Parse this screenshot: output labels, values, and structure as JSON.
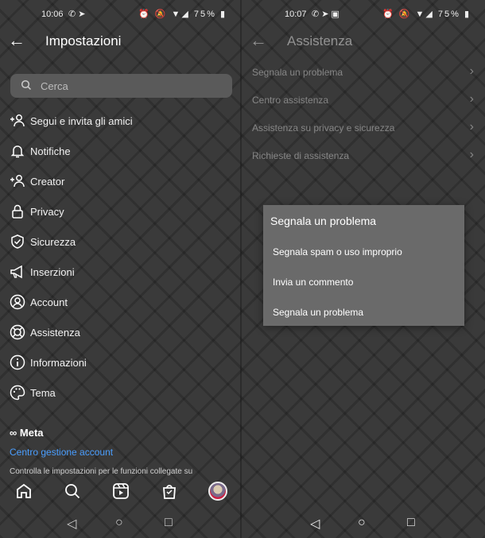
{
  "left": {
    "status": {
      "time": "10:06",
      "battery": "75%"
    },
    "header": {
      "title": "Impostazioni"
    },
    "search": {
      "placeholder": "Cerca"
    },
    "menu": [
      {
        "label": "Segui e invita gli amici",
        "icon": "add-person-icon"
      },
      {
        "label": "Notifiche",
        "icon": "bell-icon"
      },
      {
        "label": "Creator",
        "icon": "add-person-icon"
      },
      {
        "label": "Privacy",
        "icon": "lock-icon"
      },
      {
        "label": "Sicurezza",
        "icon": "shield-icon"
      },
      {
        "label": "Inserzioni",
        "icon": "megaphone-icon"
      },
      {
        "label": "Account",
        "icon": "account-icon"
      },
      {
        "label": "Assistenza",
        "icon": "lifebuoy-icon"
      },
      {
        "label": "Informazioni",
        "icon": "info-icon"
      },
      {
        "label": "Tema",
        "icon": "palette-icon"
      }
    ],
    "meta_logo": "Meta",
    "account_center_link": "Centro gestione account",
    "account_center_desc": "Controlla le impostazioni per le funzioni collegate su"
  },
  "right": {
    "status": {
      "time": "10:07",
      "battery": "75%"
    },
    "header": {
      "title": "Assistenza"
    },
    "items": [
      {
        "label": "Segnala un problema"
      },
      {
        "label": "Centro assistenza"
      },
      {
        "label": "Assistenza su privacy e sicurezza"
      },
      {
        "label": "Richieste di assistenza"
      }
    ],
    "dialog": {
      "title": "Segnala un problema",
      "options": [
        "Segnala spam o uso improprio",
        "Invia un commento",
        "Segnala un problema"
      ]
    }
  },
  "colors": {
    "link": "#4a9eff",
    "dialog_bg": "#6a6a6a",
    "search_bg": "#5a5a5a"
  }
}
